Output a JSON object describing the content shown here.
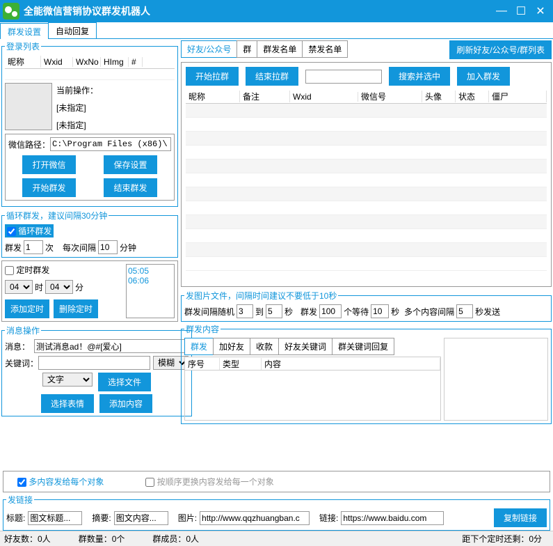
{
  "titlebar": {
    "title": "全能微信营销协议群发机器人"
  },
  "maintabs": {
    "t1": "群发设置",
    "t2": "自动回复"
  },
  "loginList": {
    "legend": "登录列表",
    "cols": {
      "c1": "昵称",
      "c2": "Wxid",
      "c3": "WxNo",
      "c4": "HImg",
      "c5": "#"
    },
    "currentOp": "当前操作：",
    "notSpec1": "[未指定]",
    "notSpec2": "[未指定]"
  },
  "wxPath": {
    "label": "微信路径：",
    "value": "C:\\Program Files (x86)\\"
  },
  "btns": {
    "openWx": "打开微信",
    "saveCfg": "保存设置",
    "startSend": "开始群发",
    "endSend": "结束群发",
    "startPull": "开始拉群",
    "endPull": "结束拉群",
    "searchSel": "搜索并选中",
    "addToSend": "加入群发",
    "refresh": "刷新好友/公众号/群列表",
    "addTimer": "添加定时",
    "delTimer": "删除定时",
    "chooseFile": "选择文件",
    "chooseEmoji": "选择表情",
    "addContent": "添加内容",
    "copyLink": "复制链接"
  },
  "loop": {
    "legend": "循环群发，建议间隔30分钟",
    "chk": "循环群发",
    "sendLabel": "群发",
    "sendVal": "1",
    "times": "次",
    "eachLabel": "每次间隔",
    "eachVal": "10",
    "min": "分钟"
  },
  "timer": {
    "chk": "定时群发",
    "hVal": "04",
    "hLbl": "时",
    "mVal": "04",
    "mLbl": "分",
    "items": [
      "05:05",
      "06:06"
    ]
  },
  "msgOp": {
    "legend": "消息操作",
    "msgLbl": "消息：",
    "msgVal": "测试消息ad！@#[爱心]",
    "kwLbl": "关键词：",
    "kwVal": "",
    "fuzzy": "模糊",
    "type": "文字"
  },
  "rightTabs": {
    "t1": "好友/公众号",
    "t2": "群",
    "t3": "群发名单",
    "t4": "禁发名单"
  },
  "gridCols": {
    "c1": "昵称",
    "c2": "备注",
    "c3": "Wxid",
    "c4": "微信号",
    "c5": "头像",
    "c6": "状态",
    "c7": "僵尸"
  },
  "picSend": {
    "legend": "发图片文件，间隔时间建议不要低于10秒",
    "l1": "群发间隔随机",
    "v1": "3",
    "l2": "到",
    "v2": "5",
    "l3": "秒",
    "l4": "群发",
    "v4": "100",
    "l5": "个等待",
    "v5": "10",
    "l6": "秒",
    "l7": "多个内容间隔",
    "v7": "5",
    "l8": "秒发送"
  },
  "sendContent": {
    "legend": "群发内容",
    "tabs": {
      "t1": "群发",
      "t2": "加好友",
      "t3": "收款",
      "t4": "好友关键词",
      "t5": "群关键词回复"
    },
    "cols": {
      "c1": "序号",
      "c2": "类型",
      "c3": "内容"
    }
  },
  "opts": {
    "multi": "多内容发给每个对象",
    "seq": "按顺序更换内容发给每一个对象"
  },
  "link": {
    "legend": "发链接",
    "titleLbl": "标题:",
    "titleVal": "图文标题...",
    "sumLbl": "摘要:",
    "sumVal": "图文内容...",
    "picLbl": "图片:",
    "picVal": "http://www.qqzhuangban.c",
    "linkLbl": "链接:",
    "linkVal": "https://www.baidu.com"
  },
  "status": {
    "friends": "好友数：0人",
    "groups": "群数量：0个",
    "members": "群成员：0人",
    "nextTimer": "距下个定时还剩：0分"
  }
}
